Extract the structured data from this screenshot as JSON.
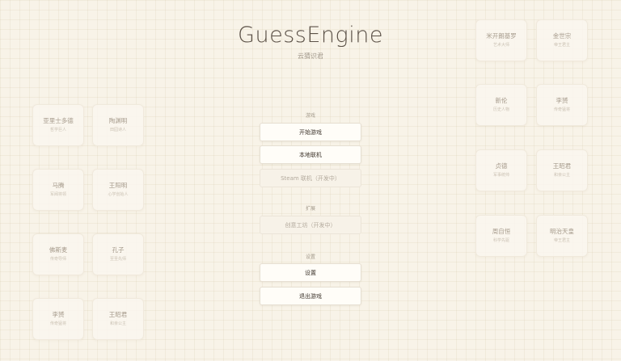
{
  "header": {
    "title": "GuessEngine",
    "subtitle": "云猜识君"
  },
  "menu": {
    "sections": [
      {
        "label": "游戏",
        "buttons": [
          {
            "label": "开始游戏",
            "disabled": false
          },
          {
            "label": "本地联机",
            "disabled": false
          },
          {
            "label": "Steam 联机（开发中）",
            "disabled": true
          }
        ]
      },
      {
        "label": "扩展",
        "buttons": [
          {
            "label": "创意工坊（开发中）",
            "disabled": true
          }
        ]
      },
      {
        "label": "设置",
        "buttons": [
          {
            "label": "设置",
            "disabled": false
          },
          {
            "label": "退出游戏",
            "disabled": false
          }
        ]
      }
    ]
  },
  "left_cards": [
    {
      "name": "亚里士多德",
      "role": "哲学巨人"
    },
    {
      "name": "陶渊明",
      "role": "田园诗人"
    },
    {
      "name": "马腾",
      "role": "军阀将领"
    },
    {
      "name": "王阳明",
      "role": "心学创始人"
    },
    {
      "name": "佛斯麦",
      "role": "传奇导师"
    },
    {
      "name": "孔子",
      "role": "至圣先师"
    },
    {
      "name": "李赟",
      "role": "传奇猛将"
    },
    {
      "name": "王昭君",
      "role": "和亲公主"
    }
  ],
  "right_cards": [
    {
      "name": "米开朗基罗",
      "role": "艺术大师"
    },
    {
      "name": "金世宗",
      "role": "帝王君主"
    },
    {
      "name": "新伦",
      "role": "历史人物"
    },
    {
      "name": "李赟",
      "role": "传奇猛将"
    },
    {
      "name": "贞德",
      "role": "军事统帅"
    },
    {
      "name": "王昭君",
      "role": "和亲公主"
    },
    {
      "name": "周自恒",
      "role": "科学先驱"
    },
    {
      "name": "明治天皇",
      "role": "帝王君主"
    }
  ]
}
